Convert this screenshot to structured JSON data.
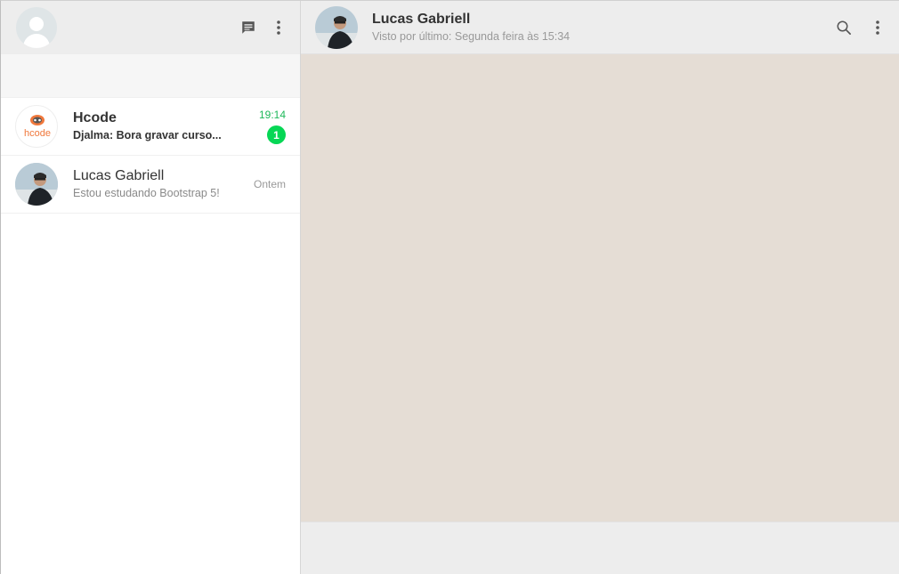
{
  "sidebar": {
    "my_avatar": "default-user-avatar",
    "icons": {
      "new_chat": "message-icon",
      "menu": "more-vertical-icon"
    },
    "chats": [
      {
        "name": "Hcode",
        "last_message": "Djalma: Bora gravar curso...",
        "time": "19:14",
        "unread_count": "1",
        "avatar_text": "hcode",
        "unread": true
      },
      {
        "name": "Lucas Gabriell",
        "last_message": "Estou estudando Bootstrap 5!",
        "time": "Ontem",
        "unread": false
      }
    ]
  },
  "conversation": {
    "contact_name": "Lucas Gabriell",
    "contact_status": "Visto por último: Segunda feira às 15:34",
    "icons": {
      "search": "search-icon",
      "menu": "more-vertical-icon"
    }
  },
  "colors": {
    "header_bg": "#ededed",
    "chat_bg": "#e5ddd5",
    "unread_green": "#06d755",
    "time_green": "#1fb85a"
  }
}
